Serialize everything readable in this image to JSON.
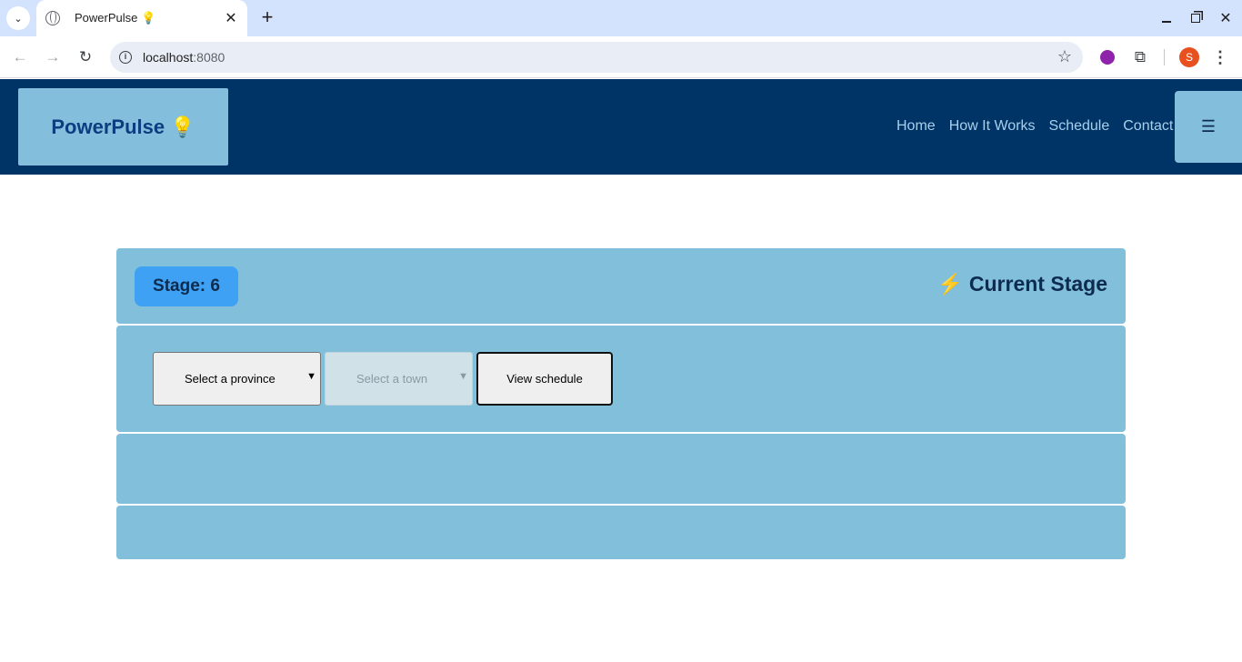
{
  "browser": {
    "tab_title": "PowerPulse 💡",
    "url_host": "localhost",
    "url_port": ":8080",
    "avatar_letter": "S"
  },
  "header": {
    "logo": "PowerPulse 💡",
    "nav": [
      "Home",
      "How It Works",
      "Schedule",
      "Contact"
    ],
    "menu_icon": "☰"
  },
  "stage": {
    "badge": "Stage: 6",
    "title": "⚡ Current Stage"
  },
  "form": {
    "province_placeholder": "Select a province",
    "town_placeholder": "Select a town",
    "view_button": "View schedule"
  }
}
